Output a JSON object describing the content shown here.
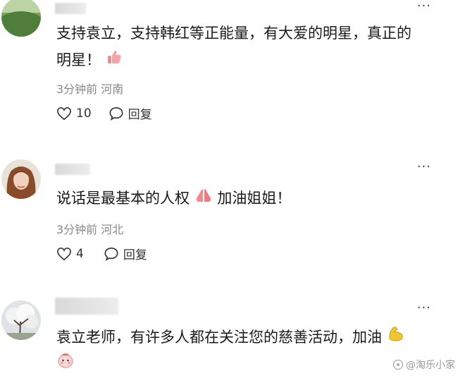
{
  "comments": [
    {
      "text_line1": "支持袁立，支持韩红等正能量，有大爱的明星，真正的",
      "text_line2": "明星！",
      "emoji": "thumbs-up-icon",
      "meta": "3分钟前 河南",
      "likes": "10",
      "reply_label": "回复"
    },
    {
      "text_line1": "说话是最基本的人权",
      "emoji": "praying-hands-icon",
      "text_after_emoji": "加油姐姐！",
      "meta": "3分钟前 河北",
      "likes": "4",
      "reply_label": "回复"
    },
    {
      "text_line1": "袁立老师，有许多人都在关注您的慈善活动，加油",
      "emoji": "flexed-biceps-icon",
      "emoji2": "cute-face-icon"
    }
  ],
  "more_label": "···",
  "watermark": "@淘乐小家",
  "colors": {
    "text": "#1a1a1a",
    "meta": "#888888",
    "accent_emoji": "#e8737a"
  }
}
